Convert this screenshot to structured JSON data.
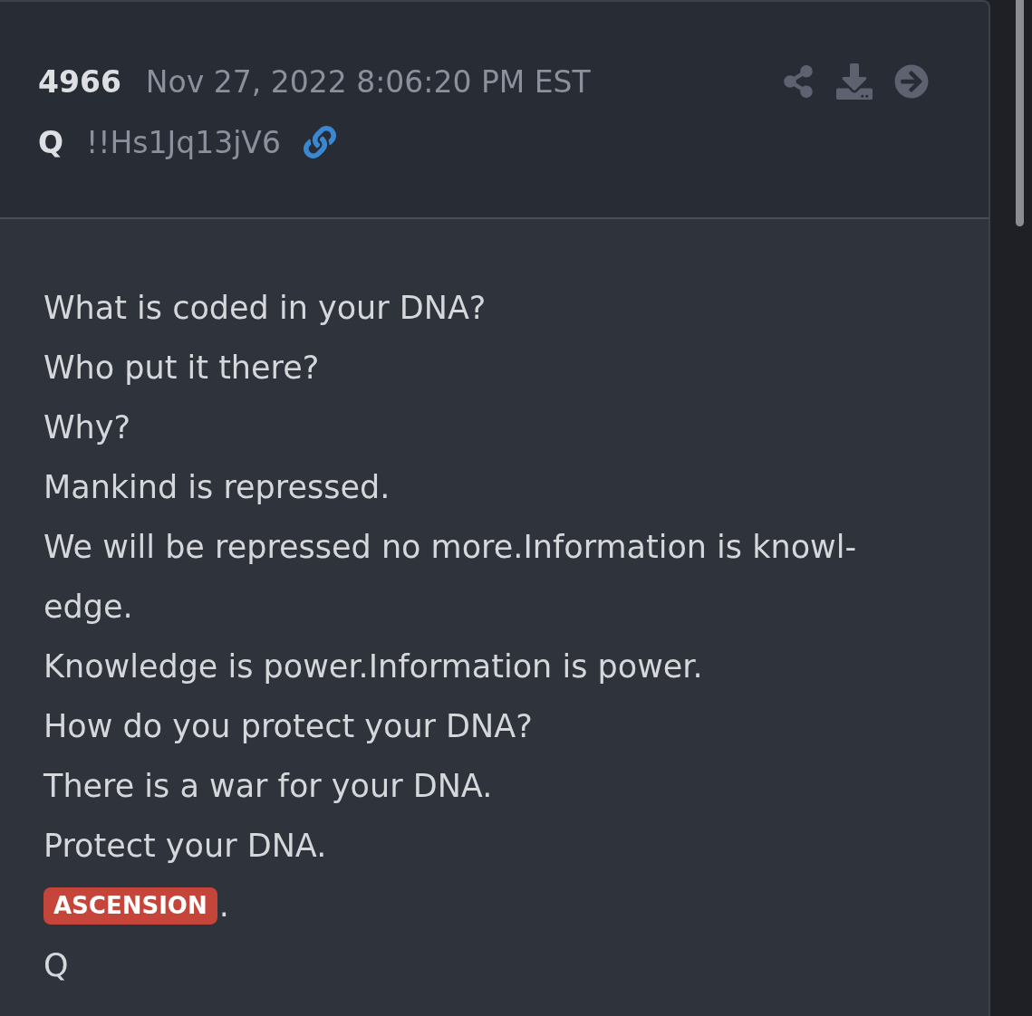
{
  "post": {
    "number": "4966",
    "timestamp": "Nov 27, 2022 8:06:20 PM EST",
    "author": "Q",
    "tripcode": "!!Hs1Jq13jV6"
  },
  "body": {
    "lines": [
      {
        "kind": "text",
        "text": "What is coded in your DNA?"
      },
      {
        "kind": "text",
        "text": "Who put it there?"
      },
      {
        "kind": "text",
        "text": "Why?"
      },
      {
        "kind": "text",
        "text": "Mankind is repressed."
      },
      {
        "kind": "text",
        "text": "We will be repressed no more.Information is knowl-"
      },
      {
        "kind": "text",
        "text": "edge."
      },
      {
        "kind": "text",
        "text": "Knowledge is power.Information is power."
      },
      {
        "kind": "text",
        "text": "How do you protect your DNA?"
      },
      {
        "kind": "text",
        "text": "There is a war for your DNA."
      },
      {
        "kind": "text",
        "text": "Protect your DNA."
      },
      {
        "kind": "tag",
        "tag": "ASCENSION",
        "text": "."
      },
      {
        "kind": "text",
        "text": "Q"
      }
    ]
  }
}
